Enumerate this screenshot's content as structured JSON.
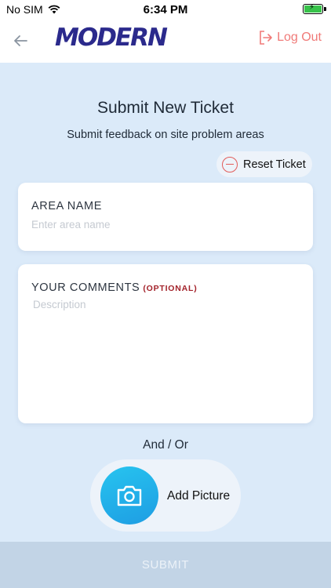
{
  "status_bar": {
    "carrier": "No SIM",
    "time": "6:34 PM",
    "icons": [
      "wifi-icon",
      "battery-charging-icon"
    ],
    "battery_color": "#38c24a"
  },
  "header": {
    "logo_text": "MODERN",
    "logout_label": "Log Out",
    "back_icon": "arrow-left-icon",
    "logout_icon": "logout-icon",
    "accent_color": "#f07a78",
    "logo_color": "#2b2a8c"
  },
  "main": {
    "title": "Submit New Ticket",
    "subtitle": "Submit feedback on site problem areas",
    "reset_label": "Reset Ticket",
    "area_name": {
      "label": "AREA NAME",
      "placeholder": "Enter area name",
      "value": ""
    },
    "comments": {
      "label": "YOUR COMMENTS",
      "optional_tag": "(OPTIONAL)",
      "placeholder": "Description",
      "value": ""
    },
    "and_or": "And / Or",
    "add_picture_label": "Add Picture",
    "camera_icon": "camera-icon"
  },
  "footer": {
    "submit_label": "SUBMIT",
    "submit_bg": "#c2d4e6"
  }
}
